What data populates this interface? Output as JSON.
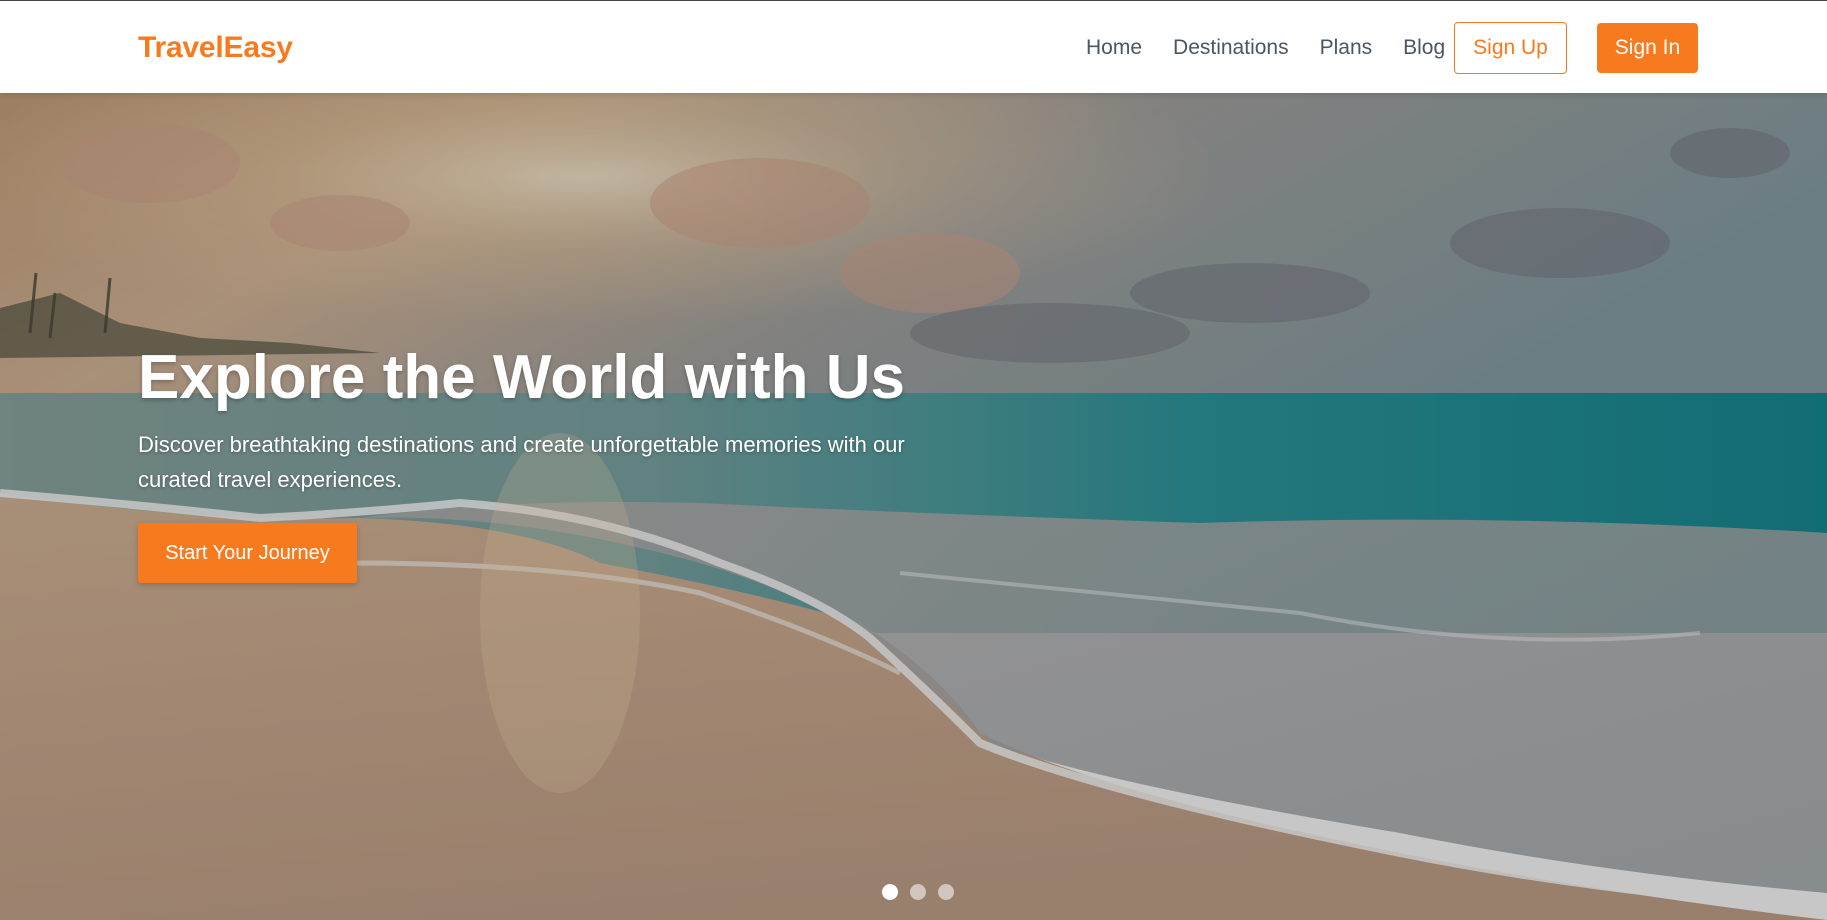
{
  "brand": {
    "name": "TravelEasy",
    "accent_color": "#f77a1e"
  },
  "nav": {
    "links": [
      "Home",
      "Destinations",
      "Plans",
      "Blog"
    ],
    "signup_label": "Sign Up",
    "signin_label": "Sign In"
  },
  "hero": {
    "title": "Explore the World with Us",
    "subtitle": "Discover breathtaking destinations and create unforgettable memories with our curated travel experiences.",
    "cta_label": "Start Your Journey",
    "background": "beach-sunset-image",
    "carousel": {
      "slide_count": 3,
      "active_index": 0
    }
  }
}
